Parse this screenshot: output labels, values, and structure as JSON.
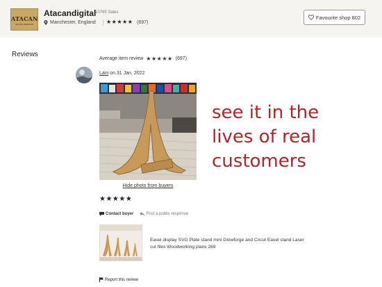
{
  "shop": {
    "logo_text": "ATACAN",
    "logo_subtext": "DIGITAL DESIGNS",
    "name": "Atacandigital",
    "sales": "10765 Sales",
    "location": "Manchester, England",
    "stars": "★★★★★",
    "rating_count": "(697)",
    "favourite_label": "Favourite shop 802"
  },
  "reviews": {
    "heading": "Reviews",
    "average_label": "Average item review",
    "average_stars": "★★★★★",
    "average_count": "(697)"
  },
  "review": {
    "author": "Lani",
    "date_text": " on 31 Jan, 2022",
    "hide_photo": "Hide photo from buyers",
    "stars": "★★★★★",
    "contact_buyer": "Contact buyer",
    "public_response": "Post a public response",
    "item_title": "Easel display SVG Plate stand mini Glowforge and Cricut Easel stand Laser cut files Woodworking plans 269",
    "report": "Report this review"
  },
  "promo": {
    "line1": "see it in the",
    "line2": "lives of real",
    "line3": "customers",
    "color": "#b0242a"
  }
}
